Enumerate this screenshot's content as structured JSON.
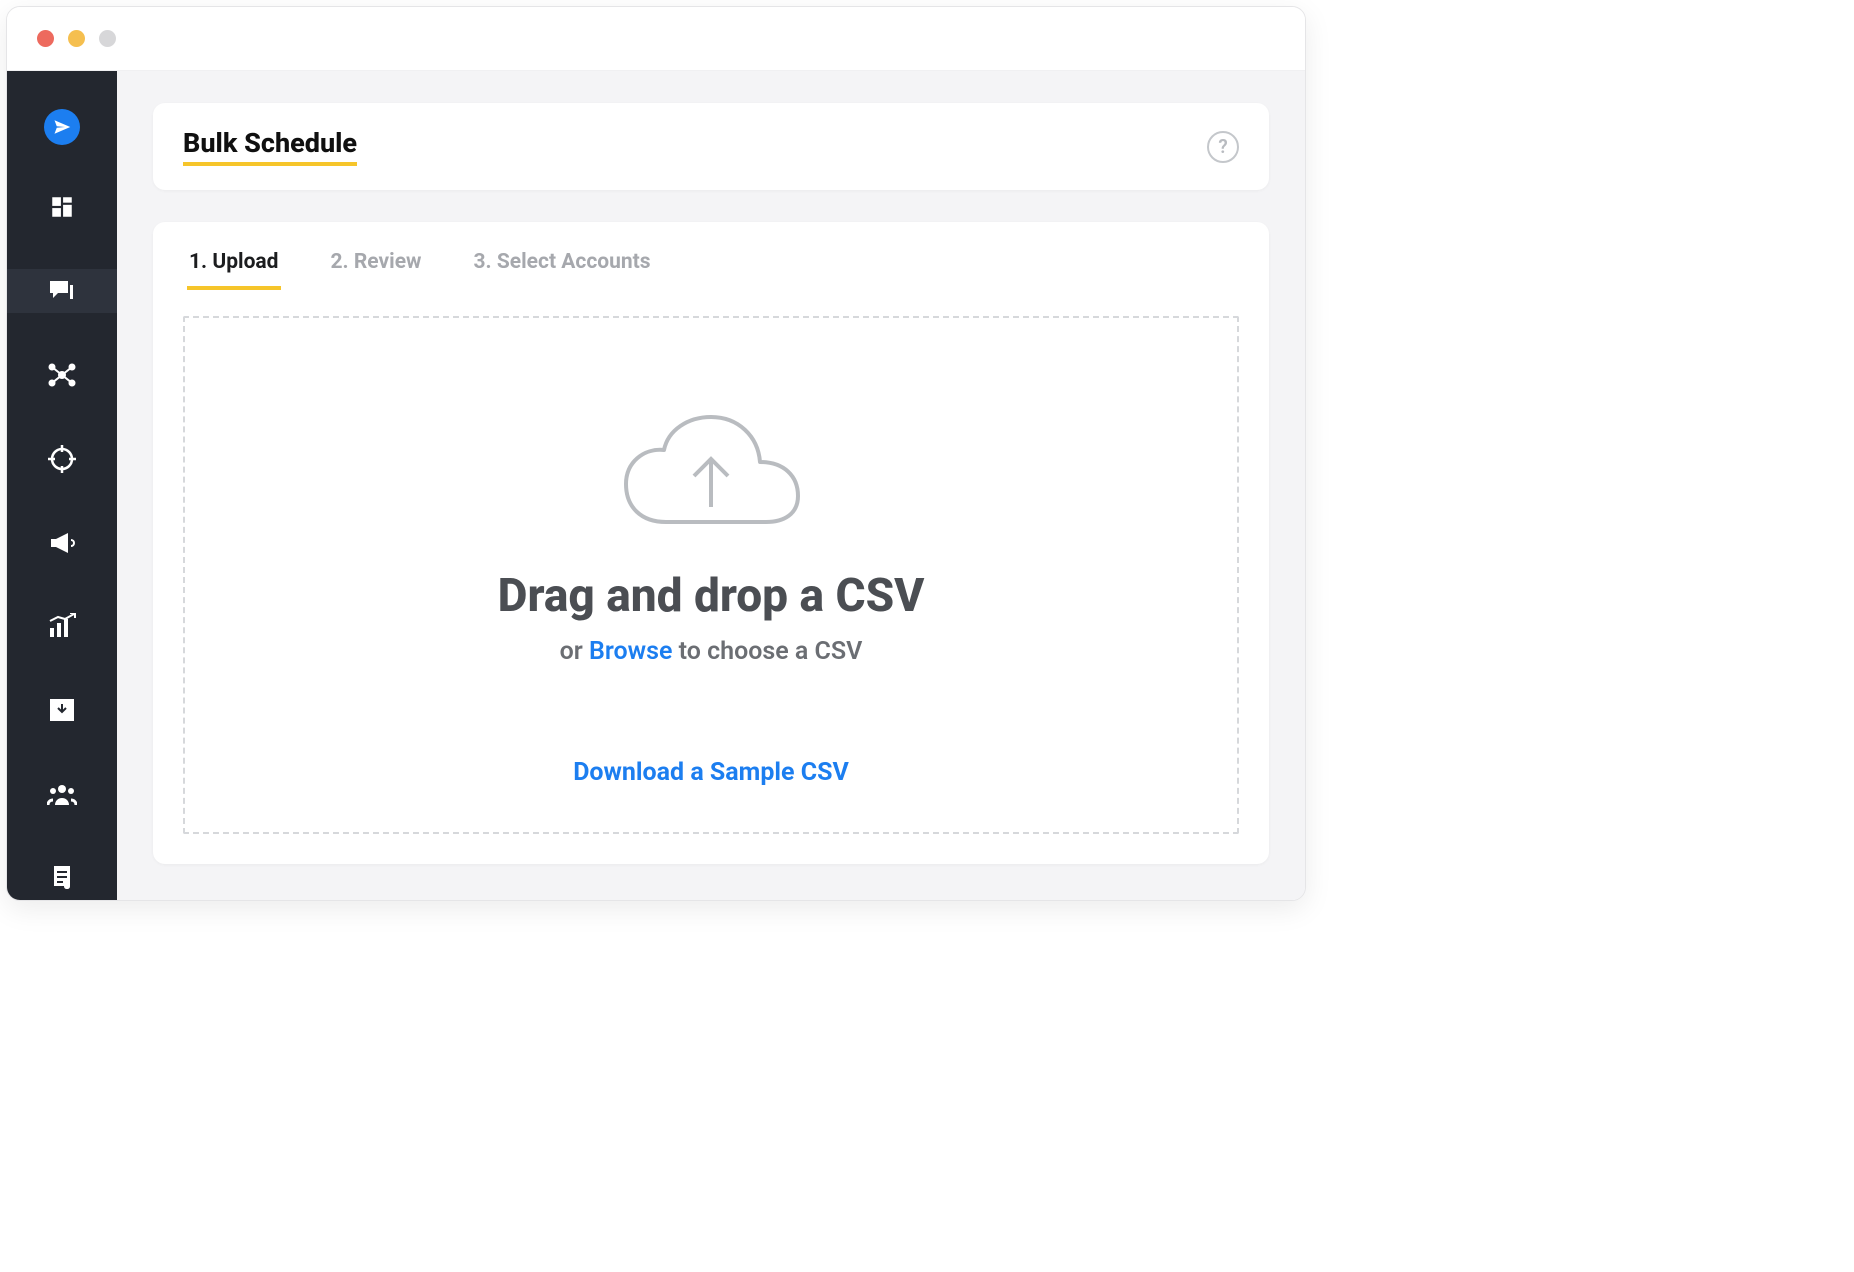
{
  "header": {
    "title": "Bulk Schedule"
  },
  "tabs": [
    {
      "label": "1. Upload",
      "active": true
    },
    {
      "label": "2. Review",
      "active": false
    },
    {
      "label": "3. Select Accounts",
      "active": false
    }
  ],
  "dropzone": {
    "title": "Drag and drop a CSV",
    "sub_prefix": "or ",
    "browse": "Browse",
    "sub_suffix": " to choose a CSV",
    "sample_link": "Download a Sample CSV"
  },
  "sidebar": {
    "items": [
      {
        "name": "logo"
      },
      {
        "name": "dashboard"
      },
      {
        "name": "compose"
      },
      {
        "name": "network"
      },
      {
        "name": "target"
      },
      {
        "name": "megaphone"
      },
      {
        "name": "analytics"
      },
      {
        "name": "inbox"
      },
      {
        "name": "team"
      },
      {
        "name": "document"
      }
    ],
    "active_index": 2
  }
}
